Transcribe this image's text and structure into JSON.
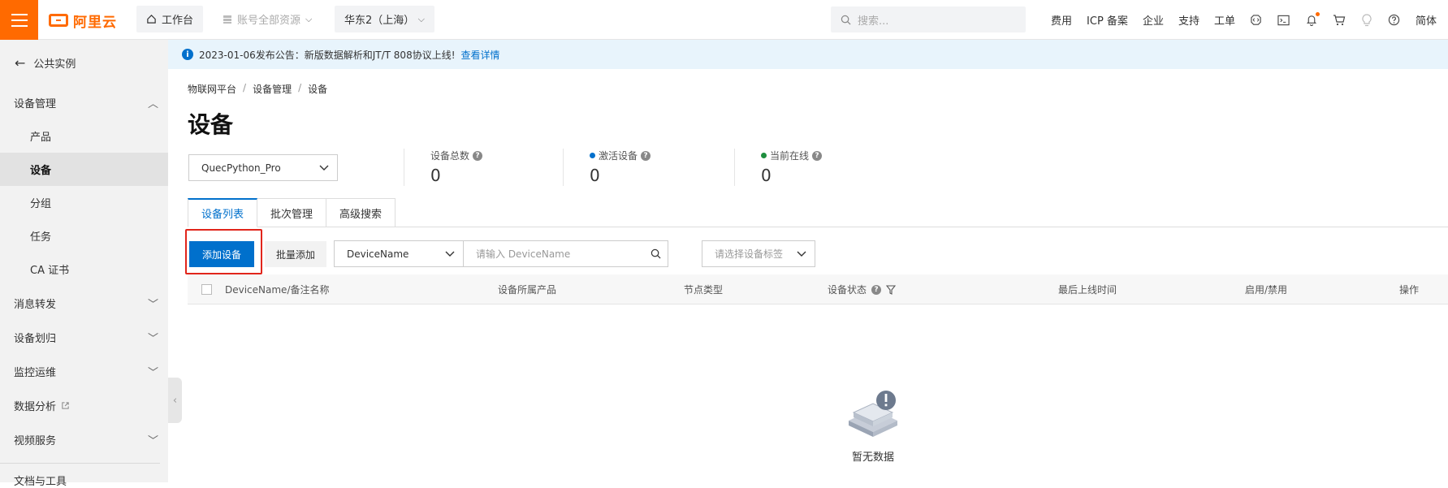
{
  "topbar": {
    "logo_text": "阿里云",
    "workbench": "工作台",
    "resources": "账号全部资源",
    "region": "华东2（上海）",
    "search_placeholder": "搜索...",
    "links": [
      "费用",
      "ICP 备案",
      "企业",
      "支持",
      "工单"
    ],
    "lang": "简体",
    "brand_color": "#ff6a00"
  },
  "sidebar": {
    "back": "公共实例",
    "groups": {
      "device_mgmt": "设备管理",
      "msg_forward": "消息转发",
      "device_assign": "设备划归",
      "monitor": "监控运维",
      "data_analysis": "数据分析",
      "video": "视频服务",
      "docs": "文档与工具"
    },
    "items": [
      "产品",
      "设备",
      "分组",
      "任务",
      "CA 证书"
    ],
    "active_item": "设备"
  },
  "notice": {
    "text": "2023-01-06发布公告：新版数据解析和JT/T 808协议上线!",
    "link": "查看详情"
  },
  "breadcrumb": [
    "物联网平台",
    "设备管理",
    "设备"
  ],
  "page_title": "设备",
  "product_select": "QuecPython_Pro",
  "stats": [
    {
      "label": "设备总数",
      "value": "0"
    },
    {
      "label": "激活设备",
      "value": "0",
      "dot_color": "#0070cc"
    },
    {
      "label": "当前在线",
      "value": "0",
      "dot_color": "#1e8e3e"
    }
  ],
  "tabs": [
    "设备列表",
    "批次管理",
    "高级搜索"
  ],
  "toolbar": {
    "add_device": "添加设备",
    "batch_add": "批量添加",
    "filter_field": "DeviceName",
    "filter_placeholder": "请输入 DeviceName",
    "tag_placeholder": "请选择设备标签"
  },
  "table": {
    "columns": [
      "DeviceName/备注名称",
      "设备所属产品",
      "节点类型",
      "设备状态",
      "最后上线时间",
      "启用/禁用",
      "操作"
    ]
  },
  "empty_text": "暂无数据",
  "accent_color": "#0070cc"
}
